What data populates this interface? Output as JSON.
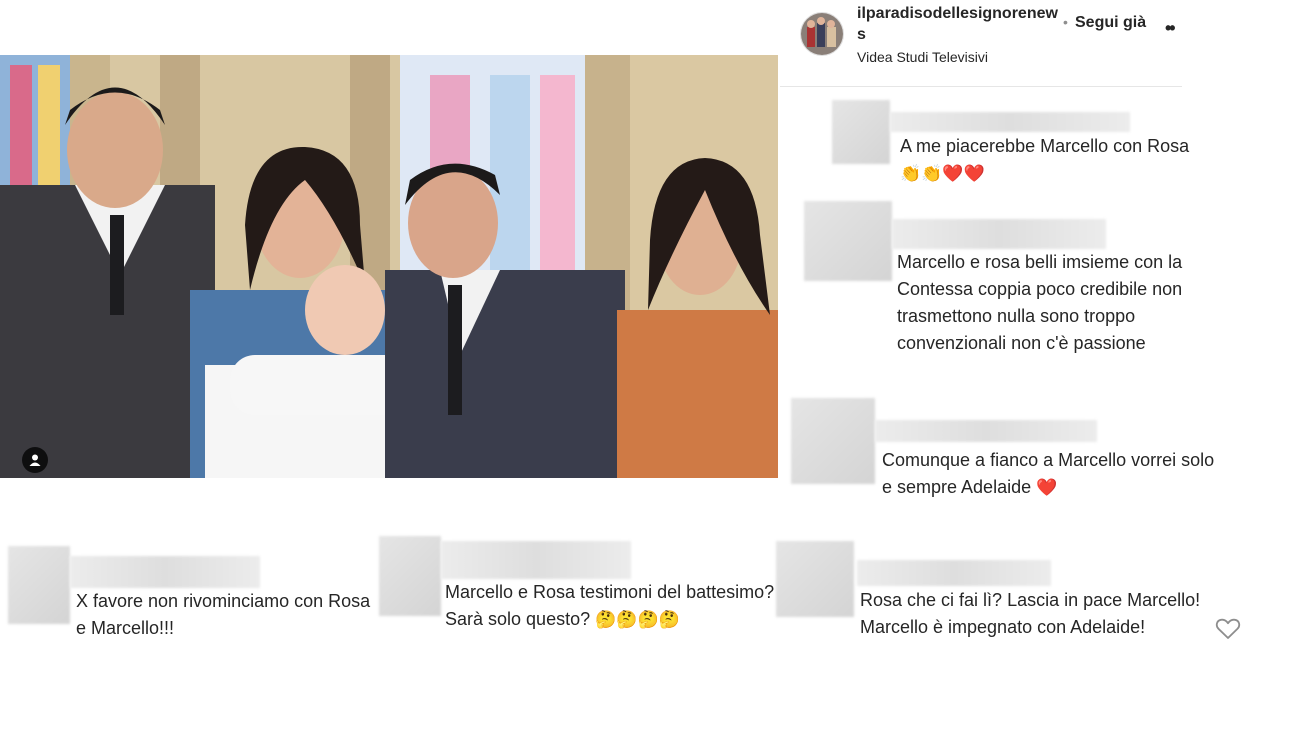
{
  "post": {
    "username": "ilparadisodellesignorenews",
    "follow_label": "Segui già",
    "dot": "•",
    "more_icon": "••",
    "location": "Videa Studi Televisivi"
  },
  "comments_right": [
    {
      "text": "A me piacerebbe Marcello con Rosa",
      "emojis": "👏👏❤️❤️"
    },
    {
      "text": "Marcello e rosa belli imsieme con la Contessa coppia poco credibile non trasmettono nulla sono troppo convenzionali non c'è passione"
    },
    {
      "text": "Comunque a fianco a Marcello vorrei solo e sempre Adelaide",
      "emojis": "❤️"
    }
  ],
  "comments_bottom": [
    {
      "text": "X favore non rivominciamo con Rosa e Marcello!!!"
    },
    {
      "text": "Marcello e Rosa testimoni del battesimo? Sarà solo questo?",
      "emojis": "🤔🤔🤔🤔"
    },
    {
      "text": "Rosa che ci fai lì? Lascia in pace Marcello! Marcello è impegnato con Adelaide!"
    }
  ],
  "icons": {
    "user_tag": "user-icon",
    "like": "heart-icon"
  }
}
